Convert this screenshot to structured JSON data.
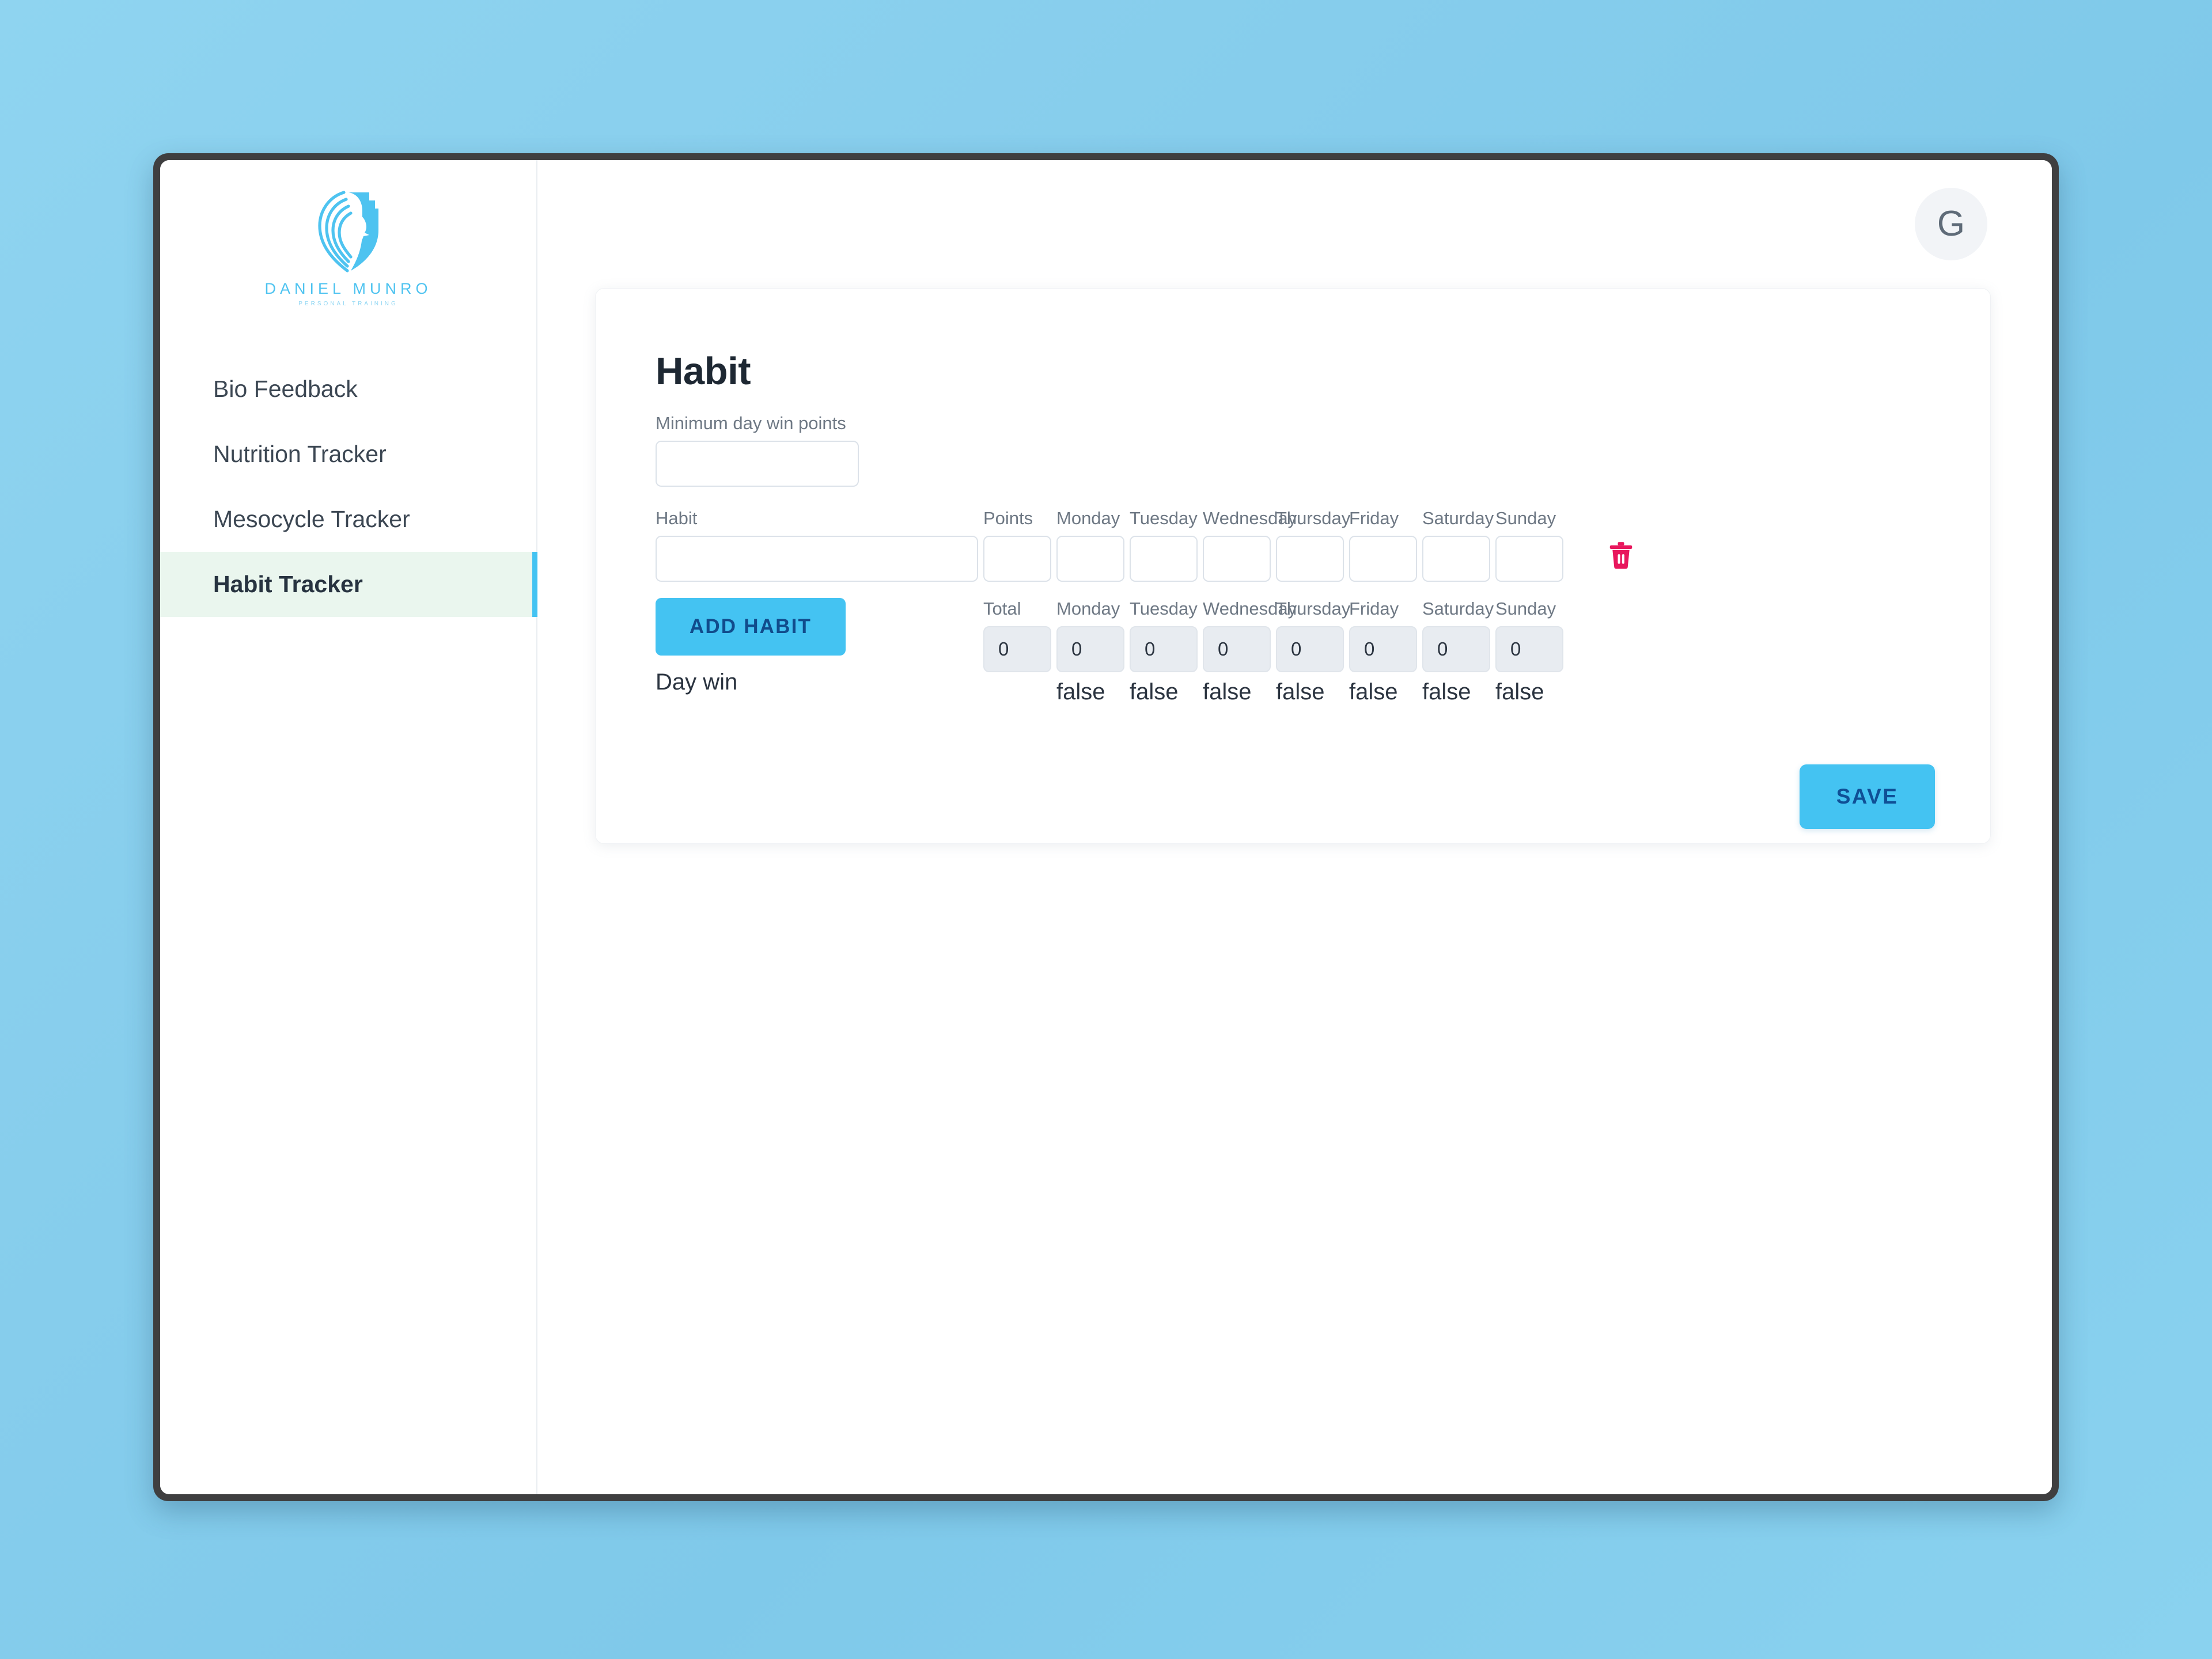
{
  "brand": {
    "logo_icon": "lion-head-shield-icon",
    "wordmark": "DANIEL  MUNRO",
    "subwordmark": "PERSONAL TRAINING"
  },
  "sidebar": {
    "items": [
      {
        "label": "Bio Feedback",
        "active": false
      },
      {
        "label": "Nutrition Tracker",
        "active": false
      },
      {
        "label": "Mesocycle Tracker",
        "active": false
      },
      {
        "label": "Habit Tracker",
        "active": true
      }
    ]
  },
  "topbar": {
    "avatar_letter": "G",
    "avatar_icon": "user-avatar-icon"
  },
  "card": {
    "title": "Habit",
    "min_points": {
      "label": "Minimum day win points",
      "value": "",
      "placeholder": ""
    },
    "entry_row": {
      "labels": {
        "habit": "Habit",
        "points": "Points",
        "monday": "Monday",
        "tuesday": "Tuesday",
        "wednesday": "Wednesday",
        "thursday": "Thursday",
        "friday": "Friday",
        "saturday": "Saturday",
        "sunday": "Sunday"
      },
      "values": {
        "habit": "",
        "points": "",
        "monday": "",
        "tuesday": "",
        "wednesday": "",
        "thursday": "",
        "friday": "",
        "saturday": "",
        "sunday": ""
      },
      "delete_icon": "trash-icon"
    },
    "totals_row": {
      "labels": {
        "total": "Total",
        "monday": "Monday",
        "tuesday": "Tuesday",
        "wednesday": "Wednesday",
        "thursday": "Thursday",
        "friday": "Friday",
        "saturday": "Saturday",
        "sunday": "Sunday"
      },
      "values": {
        "total": "0",
        "monday": "0",
        "tuesday": "0",
        "wednesday": "0",
        "thursday": "0",
        "friday": "0",
        "saturday": "0",
        "sunday": "0"
      },
      "day_win_flags": {
        "monday": "false",
        "tuesday": "false",
        "wednesday": "false",
        "thursday": "false",
        "friday": "false",
        "saturday": "false",
        "sunday": "false"
      }
    },
    "add_habit_label": "ADD HABIT",
    "day_win_label": "Day win",
    "save_label": "SAVE"
  },
  "colors": {
    "accent_blue": "#44C3F2",
    "accent_blue_text": "#0F4F96",
    "active_nav_bg": "#EAF6EE",
    "delete_pink": "#E8175D",
    "window_frame": "#3F3F40",
    "background_top": "#8FD4F0",
    "background_bottom": "#7FC9EA"
  }
}
